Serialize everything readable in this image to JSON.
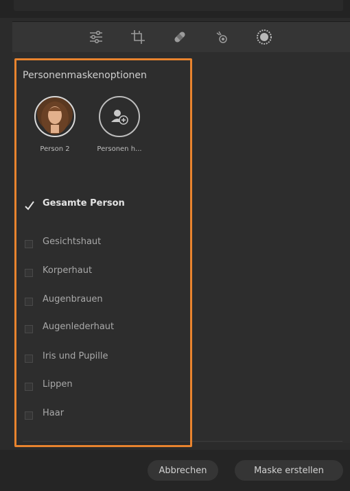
{
  "panel": {
    "title": "Personenmaskenoptionen"
  },
  "toolbar": {
    "tools": [
      "sliders-icon",
      "crop-icon",
      "healing-icon",
      "red-eye-icon",
      "mask-icon"
    ]
  },
  "people": [
    {
      "label": "Person 2",
      "avatar": "person-photo"
    },
    {
      "label": "Personen h...",
      "avatar": "add-person-icon"
    }
  ],
  "options": [
    {
      "label": "Gesamte Person",
      "checked": true
    },
    {
      "label": "Gesichtshaut",
      "checked": false
    },
    {
      "label": "Korperhaut",
      "checked": false
    },
    {
      "label": "Augenbrauen",
      "checked": false
    },
    {
      "label": "Augenlederhaut",
      "checked": false
    },
    {
      "label": "Iris und Pupille",
      "checked": false
    },
    {
      "label": "Lippen",
      "checked": false
    },
    {
      "label": "Haar",
      "checked": false
    }
  ],
  "footer": {
    "cancel_label": "Abbrechen",
    "create_label": "Maske erstellen"
  },
  "colors": {
    "highlight": "#e9842e",
    "background": "#2d2d2d"
  }
}
